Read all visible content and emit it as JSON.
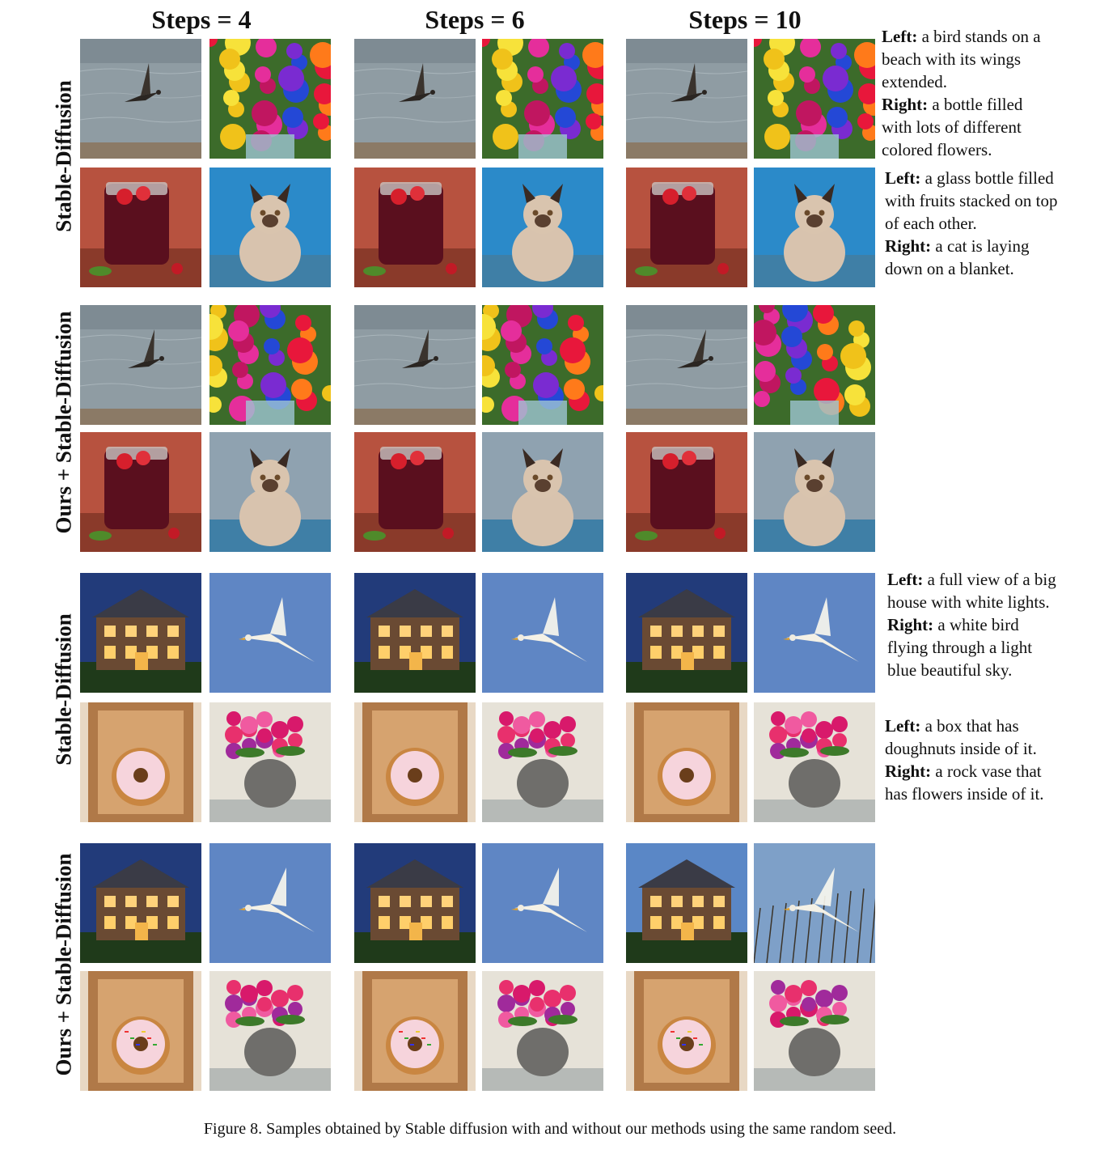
{
  "columns": [
    "Steps = 4",
    "Steps = 6",
    "Steps = 10"
  ],
  "row_labels": {
    "sd_1": "Stable-Diffusion",
    "ours_1": "Ours + Stable-Diffusion",
    "sd_2": "Stable-Diffusion",
    "ours_2": "Ours + Stable-Diffusion"
  },
  "captions": [
    {
      "left_label": "Left:",
      "left_text": " a bird stands on a beach with its wings extended.",
      "right_label": "Right:",
      "right_text": " a bottle filled with lots of different colored flowers."
    },
    {
      "left_label": "Left:",
      "left_text": " a glass bottle filled with fruits stacked on top of each other.",
      "right_label": "Right:",
      "right_text": " a cat is laying down on a blanket."
    },
    {
      "left_label": "Left:",
      "left_text": " a full view of a big house with white lights.",
      "right_label": "Right:",
      "right_text": " a white bird flying through a light blue beautiful sky."
    },
    {
      "left_label": "Left:",
      "left_text": " a box that has doughnuts inside of it.",
      "right_label": "Right:",
      "right_text": " a rock vase that has flowers inside of it."
    }
  ],
  "figure_caption": "Figure 8. Samples obtained by Stable diffusion with and without our methods using the same random seed."
}
